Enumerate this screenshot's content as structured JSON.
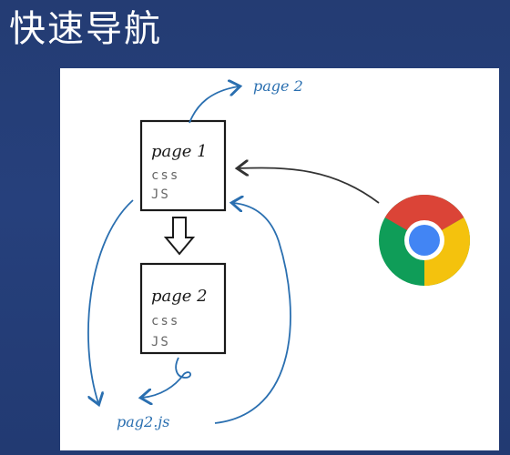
{
  "slide": {
    "title": "快速导航"
  },
  "diagram": {
    "box1": {
      "title": "page 1",
      "line1": "css",
      "line2": "JS"
    },
    "box2": {
      "title": "page 2",
      "line1": "css",
      "line2": "JS"
    },
    "label_page2": "page 2",
    "label_page2js": "pag2.js",
    "browser_icon": "chrome-icon",
    "colors": {
      "ink": "#1a1a1a",
      "arrow_blue": "#2a6fb0",
      "chrome_red": "#db4437",
      "chrome_yellow": "#f4c20d",
      "chrome_green": "#0f9d58",
      "chrome_blue": "#4285f4"
    }
  }
}
